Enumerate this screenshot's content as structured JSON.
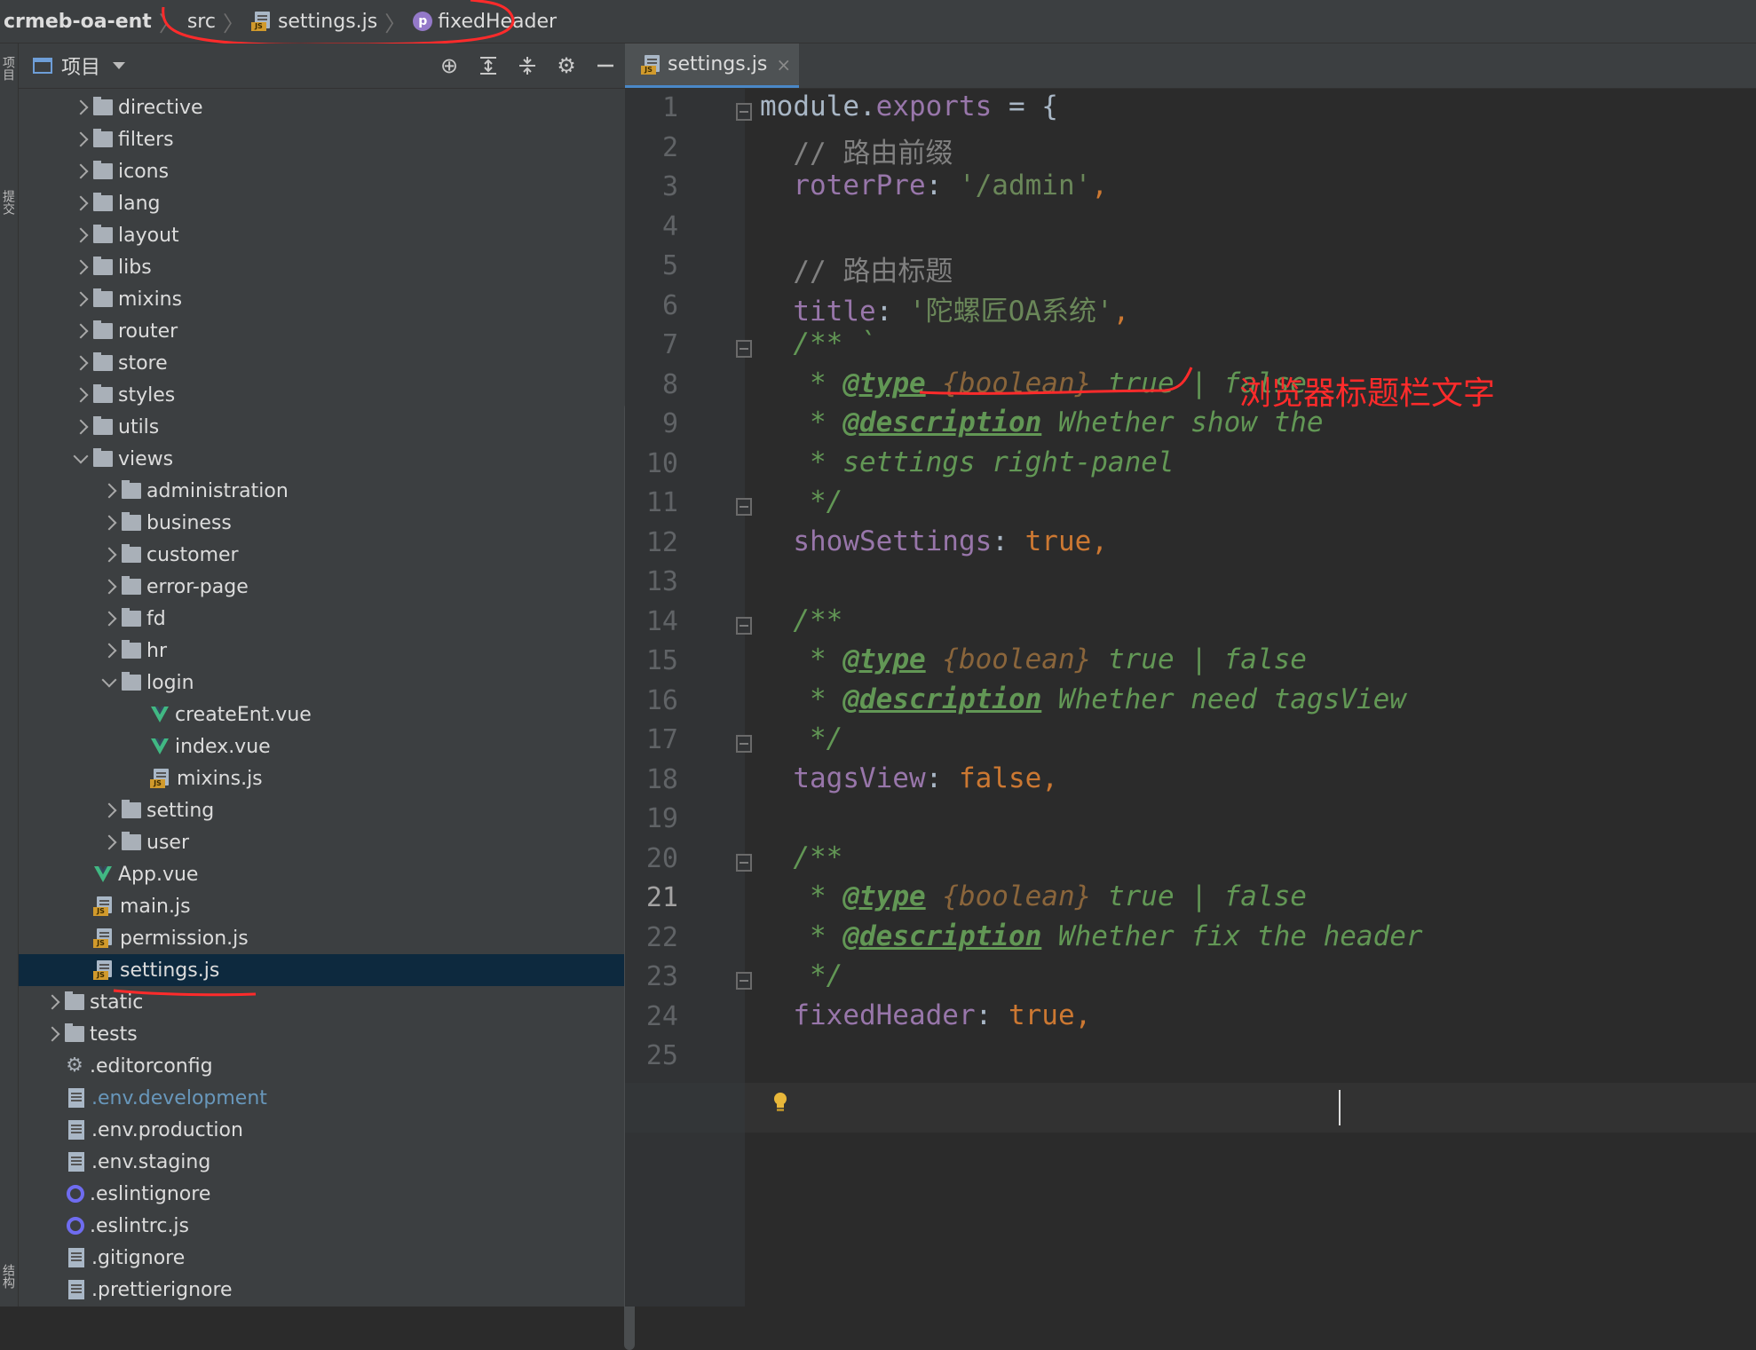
{
  "breadcrumb": {
    "project": "crmeb-oa-ent",
    "items": [
      "src",
      "settings.js",
      "fixedHeader"
    ]
  },
  "left_strip": {
    "tab_project": "项目",
    "tab_commit": "提交",
    "tab_structure": "结构"
  },
  "project_panel": {
    "title": "项目",
    "tools": [
      "locate-icon",
      "expand-all-icon",
      "collapse-all-icon",
      "gear-icon",
      "minimize-icon"
    ]
  },
  "tree": [
    {
      "label": "directive",
      "type": "folder",
      "depth": 2,
      "expanded": false
    },
    {
      "label": "filters",
      "type": "folder",
      "depth": 2,
      "expanded": false
    },
    {
      "label": "icons",
      "type": "folder",
      "depth": 2,
      "expanded": false
    },
    {
      "label": "lang",
      "type": "folder",
      "depth": 2,
      "expanded": false
    },
    {
      "label": "layout",
      "type": "folder",
      "depth": 2,
      "expanded": false
    },
    {
      "label": "libs",
      "type": "folder",
      "depth": 2,
      "expanded": false
    },
    {
      "label": "mixins",
      "type": "folder",
      "depth": 2,
      "expanded": false
    },
    {
      "label": "router",
      "type": "folder",
      "depth": 2,
      "expanded": false
    },
    {
      "label": "store",
      "type": "folder",
      "depth": 2,
      "expanded": false
    },
    {
      "label": "styles",
      "type": "folder",
      "depth": 2,
      "expanded": false
    },
    {
      "label": "utils",
      "type": "folder",
      "depth": 2,
      "expanded": false
    },
    {
      "label": "views",
      "type": "folder",
      "depth": 2,
      "expanded": true
    },
    {
      "label": "administration",
      "type": "folder",
      "depth": 3,
      "expanded": false
    },
    {
      "label": "business",
      "type": "folder",
      "depth": 3,
      "expanded": false
    },
    {
      "label": "customer",
      "type": "folder",
      "depth": 3,
      "expanded": false
    },
    {
      "label": "error-page",
      "type": "folder",
      "depth": 3,
      "expanded": false
    },
    {
      "label": "fd",
      "type": "folder",
      "depth": 3,
      "expanded": false
    },
    {
      "label": "hr",
      "type": "folder",
      "depth": 3,
      "expanded": false
    },
    {
      "label": "login",
      "type": "folder",
      "depth": 3,
      "expanded": true
    },
    {
      "label": "createEnt.vue",
      "type": "vue",
      "depth": 4
    },
    {
      "label": "index.vue",
      "type": "vue",
      "depth": 4
    },
    {
      "label": "mixins.js",
      "type": "js",
      "depth": 4
    },
    {
      "label": "setting",
      "type": "folder",
      "depth": 3,
      "expanded": false
    },
    {
      "label": "user",
      "type": "folder",
      "depth": 3,
      "expanded": false
    },
    {
      "label": "App.vue",
      "type": "vue",
      "depth": 2
    },
    {
      "label": "main.js",
      "type": "js",
      "depth": 2
    },
    {
      "label": "permission.js",
      "type": "js",
      "depth": 2
    },
    {
      "label": "settings.js",
      "type": "js",
      "depth": 2,
      "selected": true
    },
    {
      "label": "static",
      "type": "folder",
      "depth": 1,
      "expanded": false
    },
    {
      "label": "tests",
      "type": "folder",
      "depth": 1,
      "expanded": false
    },
    {
      "label": ".editorconfig",
      "type": "config",
      "depth": 1
    },
    {
      "label": ".env.development",
      "type": "file",
      "depth": 1,
      "modified": true
    },
    {
      "label": ".env.production",
      "type": "file",
      "depth": 1
    },
    {
      "label": ".env.staging",
      "type": "file",
      "depth": 1
    },
    {
      "label": ".eslintignore",
      "type": "eslint",
      "depth": 1
    },
    {
      "label": ".eslintrc.js",
      "type": "eslint",
      "depth": 1
    },
    {
      "label": ".gitignore",
      "type": "file",
      "depth": 1
    },
    {
      "label": ".prettierignore",
      "type": "file",
      "depth": 1
    }
  ],
  "editor": {
    "tab_label": "settings.js",
    "current_line": 21,
    "annotation": "浏览器标题栏文字",
    "lines": [
      [
        {
          "t": "module",
          "c": "plain"
        },
        {
          "t": ".",
          "c": "plain"
        },
        {
          "t": "exports",
          "c": "prop"
        },
        {
          "t": " = {",
          "c": "plain"
        }
      ],
      [
        {
          "t": "  // 路由前缀",
          "c": "cmt"
        }
      ],
      [
        {
          "t": "  ",
          "c": "plain"
        },
        {
          "t": "roterPre",
          "c": "prop"
        },
        {
          "t": ": ",
          "c": "plain"
        },
        {
          "t": "'/admin'",
          "c": "str"
        },
        {
          "t": ",",
          "c": "kw"
        }
      ],
      [],
      [
        {
          "t": "  // 路由标题",
          "c": "cmt"
        }
      ],
      [
        {
          "t": "  ",
          "c": "plain"
        },
        {
          "t": "title",
          "c": "prop"
        },
        {
          "t": ": ",
          "c": "plain"
        },
        {
          "t": "'陀螺匠OA系统'",
          "c": "str"
        },
        {
          "t": ",",
          "c": "kw"
        }
      ],
      [
        {
          "t": "  /** `",
          "c": "doc"
        }
      ],
      [
        {
          "t": "   * ",
          "c": "doc"
        },
        {
          "t": "@type",
          "c": "doctag"
        },
        {
          "t": " {boolean}",
          "c": "doctype"
        },
        {
          "t": " true | false",
          "c": "doc"
        }
      ],
      [
        {
          "t": "   * ",
          "c": "doc"
        },
        {
          "t": "@description",
          "c": "doctag"
        },
        {
          "t": " Whether show the",
          "c": "doc"
        }
      ],
      [
        {
          "t": "   * settings right-panel",
          "c": "doc"
        }
      ],
      [
        {
          "t": "   */",
          "c": "doc"
        }
      ],
      [
        {
          "t": "  ",
          "c": "plain"
        },
        {
          "t": "showSettings",
          "c": "prop"
        },
        {
          "t": ": ",
          "c": "plain"
        },
        {
          "t": "true",
          "c": "kw"
        },
        {
          "t": ",",
          "c": "kw"
        }
      ],
      [],
      [
        {
          "t": "  /**",
          "c": "doc"
        }
      ],
      [
        {
          "t": "   * ",
          "c": "doc"
        },
        {
          "t": "@type",
          "c": "doctag"
        },
        {
          "t": " {boolean}",
          "c": "doctype"
        },
        {
          "t": " true | false",
          "c": "doc"
        }
      ],
      [
        {
          "t": "   * ",
          "c": "doc"
        },
        {
          "t": "@description",
          "c": "doctag"
        },
        {
          "t": " Whether need tagsView",
          "c": "doc"
        }
      ],
      [
        {
          "t": "   */",
          "c": "doc"
        }
      ],
      [
        {
          "t": "  ",
          "c": "plain"
        },
        {
          "t": "tagsView",
          "c": "prop"
        },
        {
          "t": ": ",
          "c": "plain"
        },
        {
          "t": "false",
          "c": "kw"
        },
        {
          "t": ",",
          "c": "kw"
        }
      ],
      [],
      [
        {
          "t": "  /**",
          "c": "doc"
        }
      ],
      [
        {
          "t": "   * ",
          "c": "doc"
        },
        {
          "t": "@type",
          "c": "doctag"
        },
        {
          "t": " {boolean}",
          "c": "doctype"
        },
        {
          "t": " true | false",
          "c": "doc"
        }
      ],
      [
        {
          "t": "   * ",
          "c": "doc"
        },
        {
          "t": "@description",
          "c": "doctag"
        },
        {
          "t": " Whether fix the header",
          "c": "doc"
        }
      ],
      [
        {
          "t": "   */",
          "c": "doc"
        }
      ],
      [
        {
          "t": "  ",
          "c": "plain"
        },
        {
          "t": "fixedHeader",
          "c": "prop"
        },
        {
          "t": ": ",
          "c": "plain"
        },
        {
          "t": "true",
          "c": "kw"
        },
        {
          "t": ",",
          "c": "kw"
        }
      ],
      []
    ],
    "line_numbers": [
      "1",
      "2",
      "3",
      "4",
      "5",
      "6",
      "7",
      "8",
      "9",
      "10",
      "11",
      "12",
      "13",
      "14",
      "15",
      "16",
      "17",
      "18",
      "19",
      "20",
      "21",
      "22",
      "23",
      "24",
      "25"
    ]
  },
  "colors": {
    "annotation_red": "#ff2b2b",
    "selection": "#0d293e",
    "tab_accent": "#4a88c7"
  }
}
